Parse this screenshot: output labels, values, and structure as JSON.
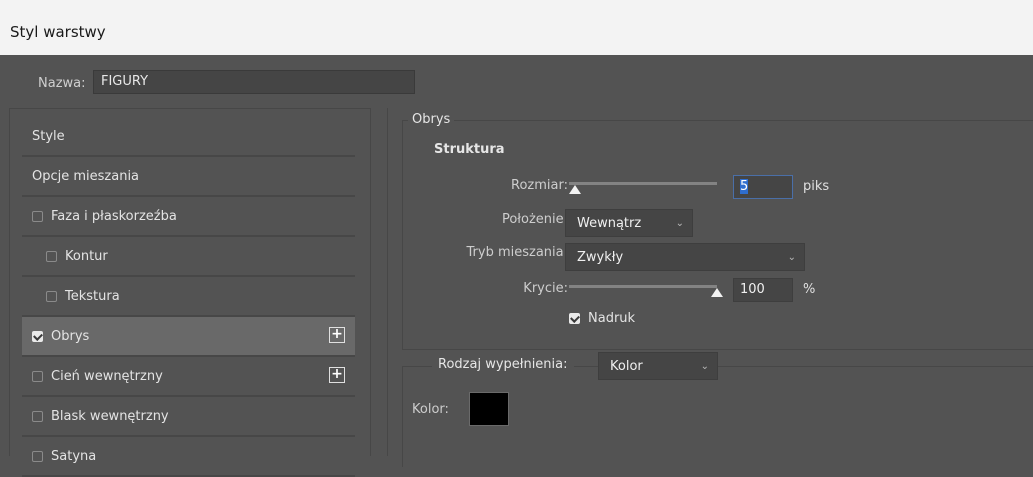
{
  "window": {
    "title": "Styl warstwy"
  },
  "name_field": {
    "label": "Nazwa:",
    "value": "FIGURY"
  },
  "sidebar": {
    "items": [
      {
        "label": "Style",
        "checkbox": false,
        "checked": false,
        "indent": false,
        "plus": false
      },
      {
        "label": "Opcje mieszania",
        "checkbox": false,
        "checked": false,
        "indent": false,
        "plus": false
      },
      {
        "label": "Faza i płaskorzeźba",
        "checkbox": true,
        "checked": false,
        "indent": false,
        "plus": false
      },
      {
        "label": "Kontur",
        "checkbox": true,
        "checked": false,
        "indent": true,
        "plus": false
      },
      {
        "label": "Tekstura",
        "checkbox": true,
        "checked": false,
        "indent": true,
        "plus": false
      },
      {
        "label": "Obrys",
        "checkbox": true,
        "checked": true,
        "indent": false,
        "plus": true,
        "selected": true
      },
      {
        "label": "Cień wewnętrzny",
        "checkbox": true,
        "checked": false,
        "indent": false,
        "plus": true
      },
      {
        "label": "Blask wewnętrzny",
        "checkbox": true,
        "checked": false,
        "indent": false,
        "plus": false
      },
      {
        "label": "Satyna",
        "checkbox": true,
        "checked": false,
        "indent": false,
        "plus": false
      }
    ],
    "plus_icon": "plus-icon"
  },
  "stroke": {
    "section_title": "Obrys",
    "structure_title": "Struktura",
    "size_label": "Rozmiar:",
    "size_value": "5",
    "size_unit": "piks",
    "size_slider_fraction": 0.04,
    "position_label": "Położenie:",
    "position_value": "Wewnątrz",
    "blend_label": "Tryb mieszania:",
    "blend_value": "Zwykły",
    "opacity_label": "Krycie:",
    "opacity_value": "100",
    "opacity_unit": "%",
    "opacity_slider_fraction": 1.0,
    "overprint_label": "Nadruk",
    "overprint_checked": true,
    "fill_type_label": "Rodzaj wypełnienia:",
    "fill_type_value": "Kolor",
    "color_label": "Kolor:",
    "color_value": "#000000"
  }
}
